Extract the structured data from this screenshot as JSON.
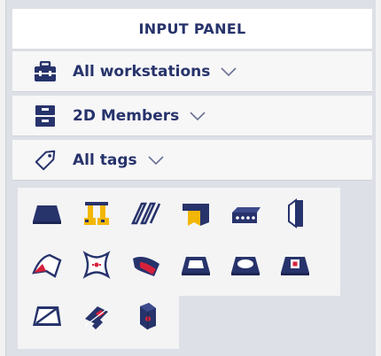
{
  "panel": {
    "title": "INPUT PANEL"
  },
  "filters": [
    {
      "label": "All workstations",
      "icon": "toolbox-icon"
    },
    {
      "label": "2D Members",
      "icon": "cabinet-icon"
    },
    {
      "label": "All tags",
      "icon": "tag-icon"
    }
  ],
  "colors": {
    "navy": "#27336b",
    "accent_red": "#d6213b",
    "accent_yellow": "#f2b705",
    "panel_bg": "#dde0e6"
  },
  "gallery": {
    "items": [
      "slab-icon",
      "load-panel-icon",
      "ribbed-slab-icon",
      "wall-slab-joint-icon",
      "hollow-core-slab-icon",
      "wall-icon",
      "shell-surface-icon",
      "curved-shell-icon",
      "shell-load-icon",
      "slab-opening-icon",
      "cutout-icon",
      "slab-insert-icon",
      "sloped-slab-icon",
      "subregion-icon",
      "thickness-point-icon"
    ]
  }
}
